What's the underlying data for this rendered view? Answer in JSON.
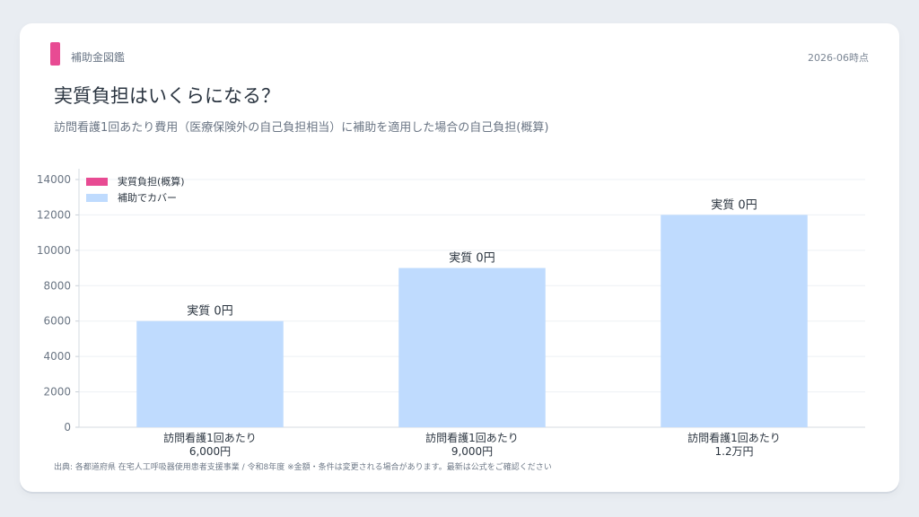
{
  "header": {
    "brand": "補助金図鑑",
    "date": "2026-06時点",
    "title": "実質負担はいくらになる？",
    "subtitle": "訪問看護1回あたり費用（医療保険外の自己負担相当）に補助を適用した場合の自己負担(概算)"
  },
  "footer": {
    "source": "出典: 各都道府県 在宅人工呼吸器使用患者支援事業 / 令和8年度 ※金額・条件は変更される場合があります。最新は公式をご確認ください"
  },
  "colors": {
    "accent": "#e84b93",
    "self_pay": "#e84b93",
    "covered": "#bfdbfe"
  },
  "chart_data": {
    "type": "bar",
    "stacked": true,
    "categories": [
      [
        "訪問看護1回あたり",
        "6,000円"
      ],
      [
        "訪問看護1回あたり",
        "9,000円"
      ],
      [
        "訪問看護1回あたり",
        "1.2万円"
      ]
    ],
    "series": [
      {
        "name": "実質負担(概算)",
        "values": [
          0,
          0,
          0
        ],
        "color": "#e84b93"
      },
      {
        "name": "補助でカバー",
        "values": [
          6000,
          9000,
          12000
        ],
        "color": "#bfdbfe"
      }
    ],
    "data_labels": [
      "実質 0円",
      "実質 0円",
      "実質 0円"
    ],
    "ylim": [
      0,
      14000
    ],
    "yticks": [
      0,
      2000,
      4000,
      6000,
      8000,
      10000,
      12000,
      14000
    ],
    "grid": true,
    "legend": "top-left"
  }
}
